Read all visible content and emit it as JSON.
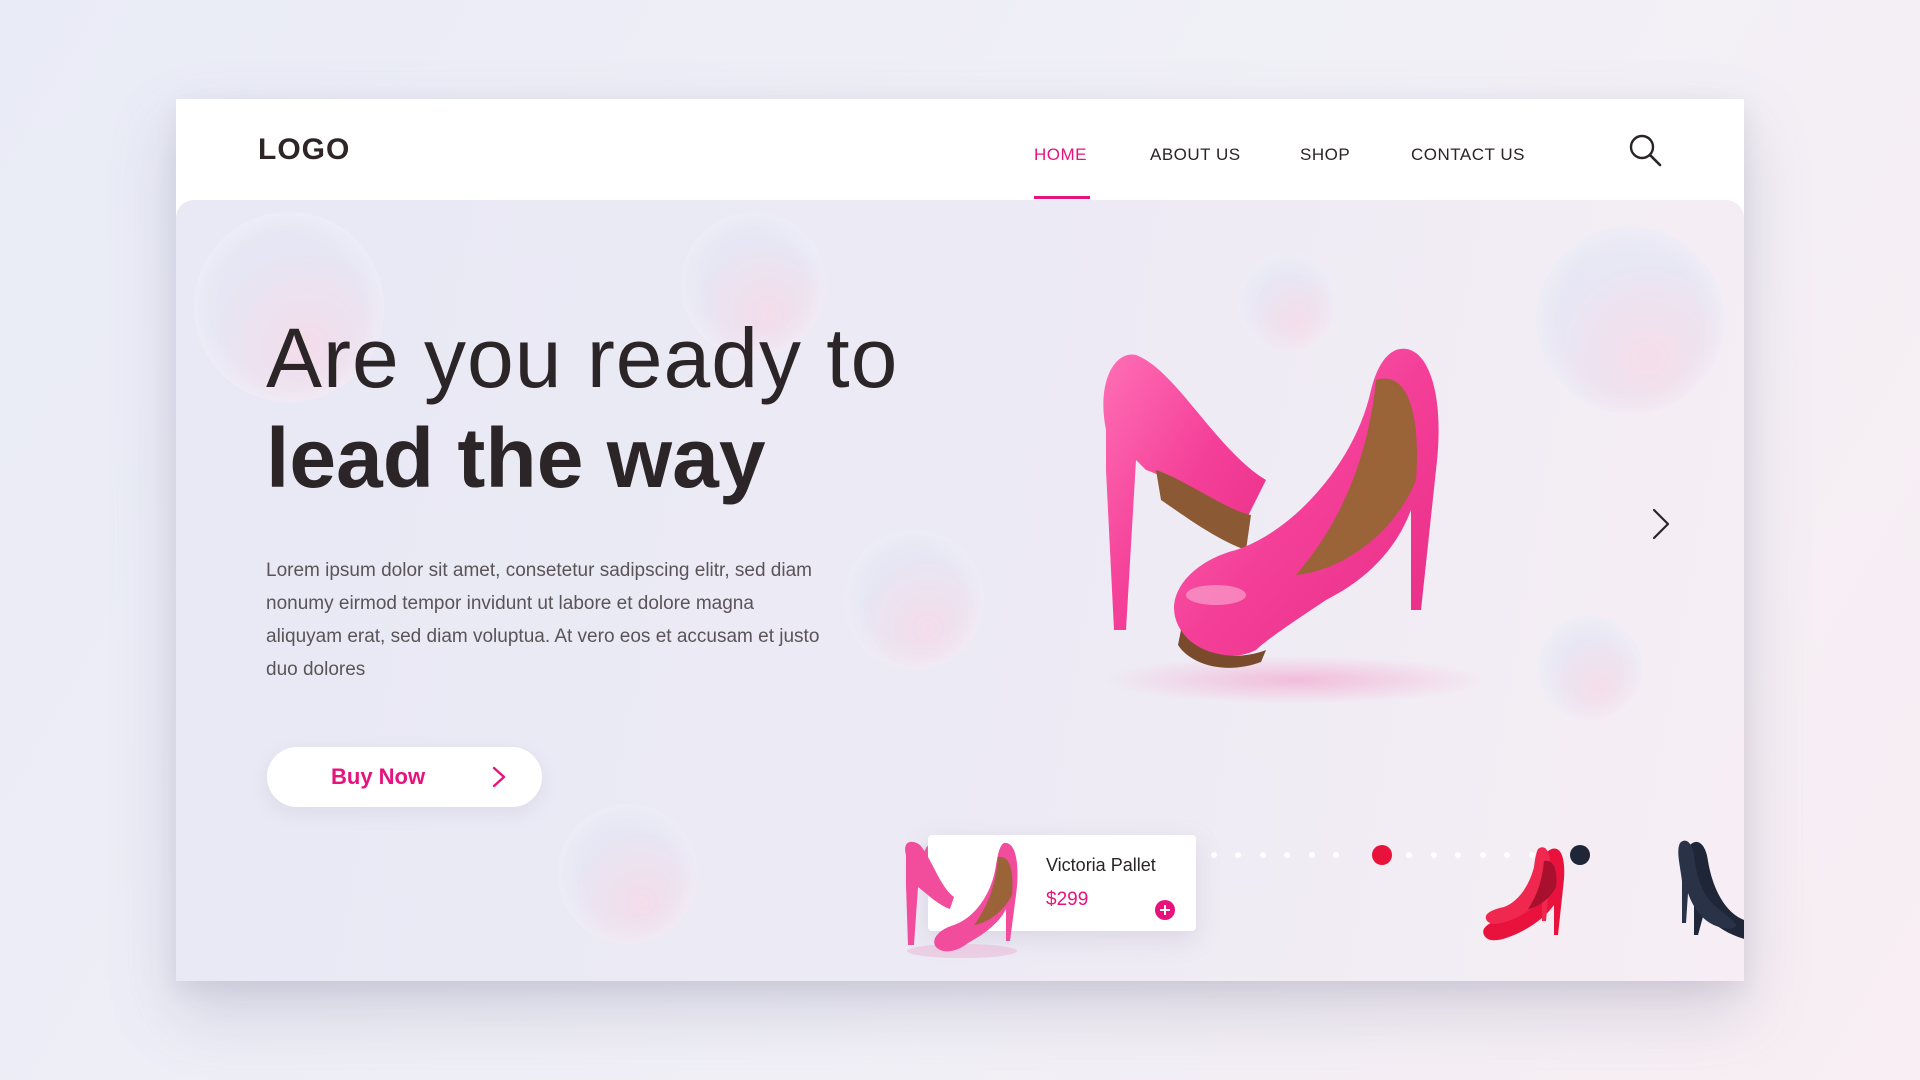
{
  "header": {
    "logo": "LOGO",
    "nav": [
      {
        "label": "HOME",
        "active": true
      },
      {
        "label": "ABOUT US",
        "active": false
      },
      {
        "label": "SHOP",
        "active": false
      },
      {
        "label": "CONTACT US",
        "active": false
      }
    ],
    "search_icon": "search-icon"
  },
  "hero": {
    "headline_light": "Are you ready to",
    "headline_bold": "lead the way",
    "body": "Lorem ipsum dolor sit amet, consetetur sadipscing elitr, sed diam nonumy eirmod tempor invidunt ut labore et dolore magna aliquyam erat, sed diam voluptua. At vero eos et accusam et justo duo dolores",
    "cta_label": "Buy Now",
    "next_icon": "chevron-right-icon"
  },
  "products": [
    {
      "name": "Victoria Pallet",
      "price": "$299",
      "color": "#f24c9c"
    },
    {
      "color": "#e8123c"
    },
    {
      "color": "#1f2638"
    }
  ],
  "colors": {
    "accent": "#e8127c",
    "dot_pink": "#f0569c",
    "dot_red": "#e8123c",
    "dot_navy": "#1f2638",
    "text_dark": "#2c2527"
  }
}
